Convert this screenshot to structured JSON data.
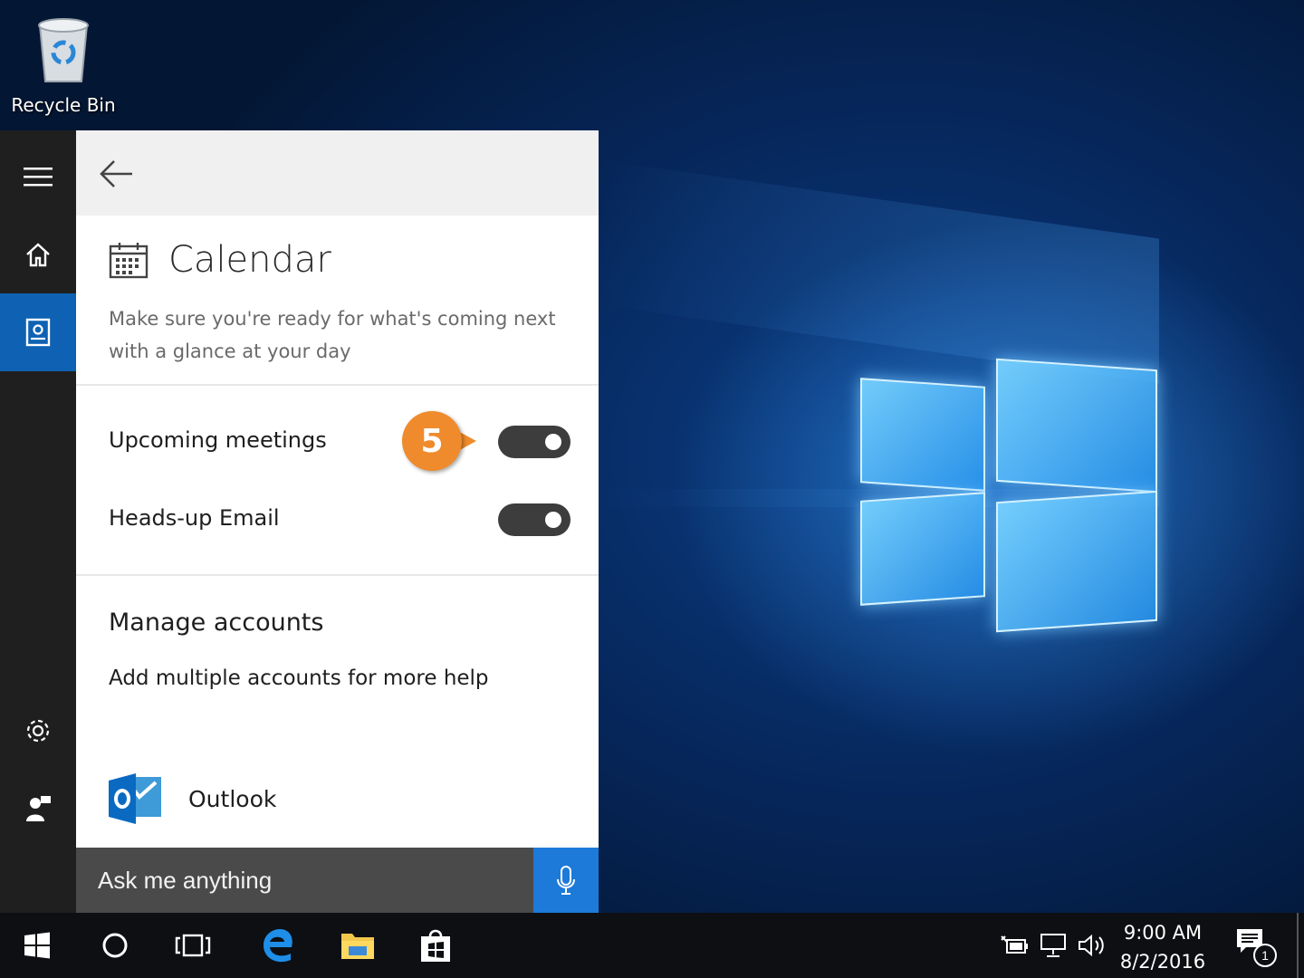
{
  "desktop": {
    "recycle_bin_label": "Recycle Bin"
  },
  "sidebar": {
    "items": [
      {
        "icon": "hamburger-menu-icon"
      },
      {
        "icon": "home-icon"
      },
      {
        "icon": "notebook-icon",
        "active": true
      },
      {
        "icon": "gear-icon"
      },
      {
        "icon": "feedback-icon"
      }
    ]
  },
  "panel": {
    "title": "Calendar",
    "description": "Make sure you're ready for what's coming next with a glance at your day",
    "settings": [
      {
        "label": "Upcoming meetings",
        "state": "on"
      },
      {
        "label": "Heads-up Email",
        "state": "on"
      }
    ],
    "manage_title": "Manage accounts",
    "manage_subtitle": "Add multiple accounts for more help",
    "account_label": "Outlook"
  },
  "callout": {
    "number": "5"
  },
  "search": {
    "placeholder": "Ask me anything"
  },
  "taskbar": {
    "time": "9:00 AM",
    "date": "8/2/2016",
    "notification_count": "1"
  },
  "colors": {
    "accent": "#0f62b3",
    "callout": "#ef8b2c",
    "toggle_on": "#3d3d3d"
  }
}
